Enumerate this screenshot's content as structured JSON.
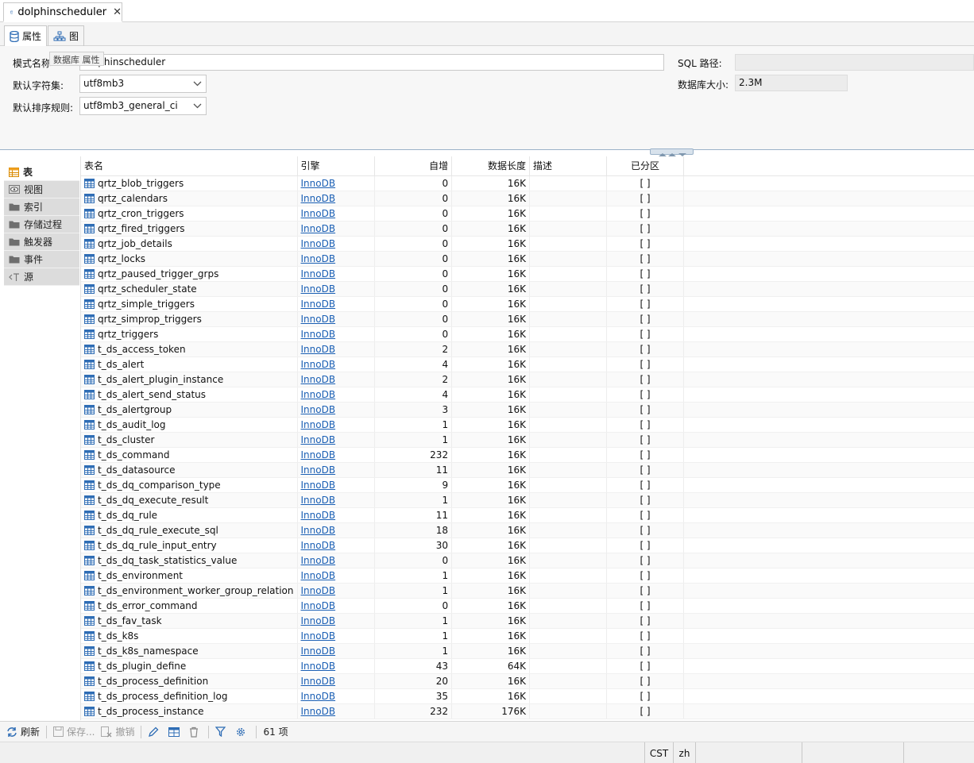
{
  "editor_tab": {
    "title": "dolphinscheduler"
  },
  "subtabs": [
    {
      "label": "属性"
    },
    {
      "label": "图"
    }
  ],
  "form": {
    "schema_name_label": "模式名称",
    "schema_name_value": "dolphinscheduler",
    "tooltip": "数据库 属性",
    "charset_label": "默认字符集:",
    "charset_value": "utf8mb3",
    "collation_label": "默认排序规则:",
    "collation_value": "utf8mb3_general_ci",
    "sql_path_label": "SQL 路径:",
    "sql_path_value": "",
    "db_size_label": "数据库大小:",
    "db_size_value": "2.3M"
  },
  "sidebar": {
    "items": [
      {
        "label": "表",
        "icon": "table-icon"
      },
      {
        "label": "视图",
        "icon": "eye-icon"
      },
      {
        "label": "索引",
        "icon": "folder-icon"
      },
      {
        "label": "存储过程",
        "icon": "folder-icon"
      },
      {
        "label": "触发器",
        "icon": "folder-icon"
      },
      {
        "label": "事件",
        "icon": "folder-icon"
      },
      {
        "label": "源",
        "icon": "source-icon"
      }
    ]
  },
  "table": {
    "columns": [
      "表名",
      "引擎",
      "自增",
      "数据长度",
      "描述",
      "已分区"
    ],
    "rows": [
      [
        "qrtz_blob_triggers",
        "InnoDB",
        "0",
        "16K",
        "",
        "[ ]"
      ],
      [
        "qrtz_calendars",
        "InnoDB",
        "0",
        "16K",
        "",
        "[ ]"
      ],
      [
        "qrtz_cron_triggers",
        "InnoDB",
        "0",
        "16K",
        "",
        "[ ]"
      ],
      [
        "qrtz_fired_triggers",
        "InnoDB",
        "0",
        "16K",
        "",
        "[ ]"
      ],
      [
        "qrtz_job_details",
        "InnoDB",
        "0",
        "16K",
        "",
        "[ ]"
      ],
      [
        "qrtz_locks",
        "InnoDB",
        "0",
        "16K",
        "",
        "[ ]"
      ],
      [
        "qrtz_paused_trigger_grps",
        "InnoDB",
        "0",
        "16K",
        "",
        "[ ]"
      ],
      [
        "qrtz_scheduler_state",
        "InnoDB",
        "0",
        "16K",
        "",
        "[ ]"
      ],
      [
        "qrtz_simple_triggers",
        "InnoDB",
        "0",
        "16K",
        "",
        "[ ]"
      ],
      [
        "qrtz_simprop_triggers",
        "InnoDB",
        "0",
        "16K",
        "",
        "[ ]"
      ],
      [
        "qrtz_triggers",
        "InnoDB",
        "0",
        "16K",
        "",
        "[ ]"
      ],
      [
        "t_ds_access_token",
        "InnoDB",
        "2",
        "16K",
        "",
        "[ ]"
      ],
      [
        "t_ds_alert",
        "InnoDB",
        "4",
        "16K",
        "",
        "[ ]"
      ],
      [
        "t_ds_alert_plugin_instance",
        "InnoDB",
        "2",
        "16K",
        "",
        "[ ]"
      ],
      [
        "t_ds_alert_send_status",
        "InnoDB",
        "4",
        "16K",
        "",
        "[ ]"
      ],
      [
        "t_ds_alertgroup",
        "InnoDB",
        "3",
        "16K",
        "",
        "[ ]"
      ],
      [
        "t_ds_audit_log",
        "InnoDB",
        "1",
        "16K",
        "",
        "[ ]"
      ],
      [
        "t_ds_cluster",
        "InnoDB",
        "1",
        "16K",
        "",
        "[ ]"
      ],
      [
        "t_ds_command",
        "InnoDB",
        "232",
        "16K",
        "",
        "[ ]"
      ],
      [
        "t_ds_datasource",
        "InnoDB",
        "11",
        "16K",
        "",
        "[ ]"
      ],
      [
        "t_ds_dq_comparison_type",
        "InnoDB",
        "9",
        "16K",
        "",
        "[ ]"
      ],
      [
        "t_ds_dq_execute_result",
        "InnoDB",
        "1",
        "16K",
        "",
        "[ ]"
      ],
      [
        "t_ds_dq_rule",
        "InnoDB",
        "11",
        "16K",
        "",
        "[ ]"
      ],
      [
        "t_ds_dq_rule_execute_sql",
        "InnoDB",
        "18",
        "16K",
        "",
        "[ ]"
      ],
      [
        "t_ds_dq_rule_input_entry",
        "InnoDB",
        "30",
        "16K",
        "",
        "[ ]"
      ],
      [
        "t_ds_dq_task_statistics_value",
        "InnoDB",
        "0",
        "16K",
        "",
        "[ ]"
      ],
      [
        "t_ds_environment",
        "InnoDB",
        "1",
        "16K",
        "",
        "[ ]"
      ],
      [
        "t_ds_environment_worker_group_relation",
        "InnoDB",
        "1",
        "16K",
        "",
        "[ ]"
      ],
      [
        "t_ds_error_command",
        "InnoDB",
        "0",
        "16K",
        "",
        "[ ]"
      ],
      [
        "t_ds_fav_task",
        "InnoDB",
        "1",
        "16K",
        "",
        "[ ]"
      ],
      [
        "t_ds_k8s",
        "InnoDB",
        "1",
        "16K",
        "",
        "[ ]"
      ],
      [
        "t_ds_k8s_namespace",
        "InnoDB",
        "1",
        "16K",
        "",
        "[ ]"
      ],
      [
        "t_ds_plugin_define",
        "InnoDB",
        "43",
        "64K",
        "",
        "[ ]"
      ],
      [
        "t_ds_process_definition",
        "InnoDB",
        "20",
        "16K",
        "",
        "[ ]"
      ],
      [
        "t_ds_process_definition_log",
        "InnoDB",
        "35",
        "16K",
        "",
        "[ ]"
      ],
      [
        "t_ds_process_instance",
        "InnoDB",
        "232",
        "176K",
        "",
        "[ ]"
      ]
    ]
  },
  "toolbar": {
    "refresh": "刷新",
    "save": "保存...",
    "cancel": "撤销",
    "count": "61 项"
  },
  "statusbar": {
    "timezone": "CST",
    "locale": "zh"
  },
  "colors": {
    "link": "#1a5fb4",
    "accent_blue": "#2f6db5",
    "folder": "#6e6e6e"
  }
}
